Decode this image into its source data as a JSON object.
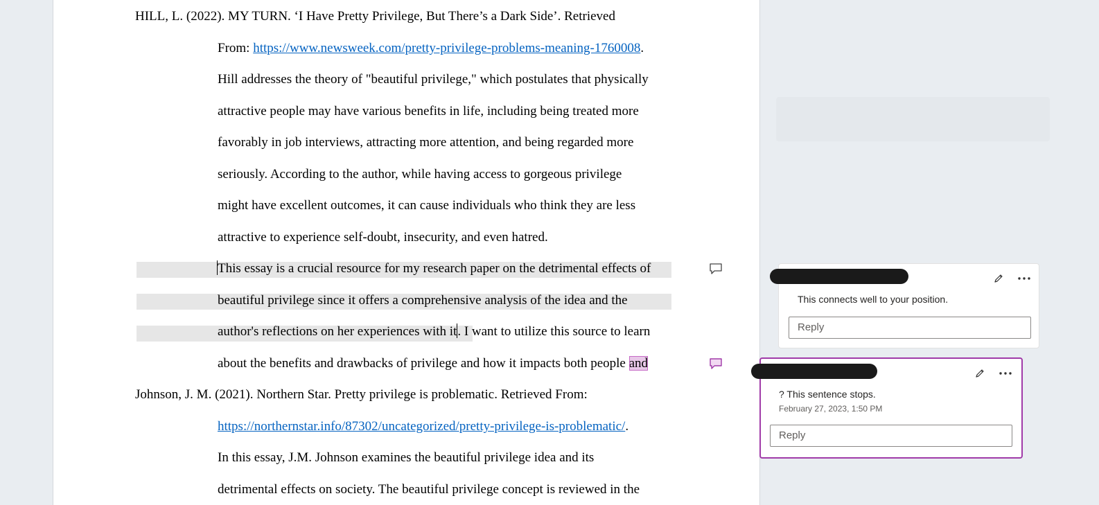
{
  "document": {
    "ref1": {
      "citation": "HILL, L. (2022). MY TURN. ‘I Have Pretty Privilege, But There’s a Dark Side’. Retrieved",
      "from_label": "From: ",
      "url": "https://www.newsweek.com/pretty-privilege-problems-meaning-1760008",
      "url_suffix": ".",
      "summary_lines": [
        "Hill addresses the theory of \"beautiful privilege,\" which postulates that physically",
        "attractive people may have various benefits in life, including being treated more",
        "favorably in job interviews, attracting more attention, and being regarded more",
        "seriously. According to the author, while having access to gorgeous privilege",
        "might have excellent outcomes, it can cause individuals who think they are less",
        "attractive to experience self-doubt, insecurity, and even hatred."
      ],
      "eval_line1": "This essay is a crucial resource for my research paper on the detrimental effects of",
      "eval_line2": "beautiful privilege since it offers a comprehensive analysis of the idea and the",
      "eval_line3_hl": "author's reflections on her experiences with it",
      "eval_line3_rest": ". I want to utilize this source to learn",
      "eval_line4": "about the benefits and drawbacks of privilege and how it impacts both people ",
      "eval_line4_sel": "and"
    },
    "ref2": {
      "citation": "Johnson, J. M. (2021). Northern Star. Pretty privilege is problematic. Retrieved From:",
      "url": "https://northernstar.info/87302/uncategorized/pretty-privilege-is-problematic/",
      "url_suffix": ".",
      "summary_lines": [
        "In this essay, J.M. Johnson examines the beautiful privilege idea and its",
        "detrimental effects on society. The beautiful privilege concept is reviewed in the"
      ]
    }
  },
  "comments": [
    {
      "text": "This connects well to your position.",
      "reply_placeholder": "Reply",
      "icons": [
        "pencil-icon",
        "more-icon"
      ]
    },
    {
      "text": "? This sentence stops.",
      "date": "February 27, 2023, 1:50 PM",
      "reply_placeholder": "Reply",
      "icons": [
        "pencil-icon",
        "more-icon"
      ]
    }
  ],
  "colors": {
    "link": "#0563c1",
    "comment_accent": "#a03aa8",
    "highlight": "#e6e6e6",
    "selection": "#e8c8e8"
  }
}
